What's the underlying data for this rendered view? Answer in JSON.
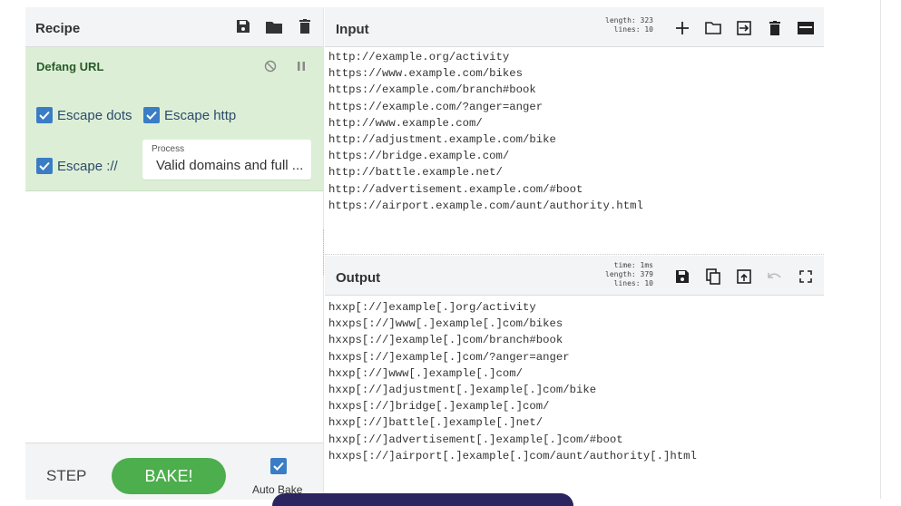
{
  "recipe": {
    "title": "Recipe",
    "icons": [
      "save-icon",
      "folder-icon",
      "trash-icon"
    ],
    "operation": {
      "name": "Defang URL",
      "escape_dots": {
        "label": "Escape dots",
        "checked": true
      },
      "escape_http": {
        "label": "Escape http",
        "checked": true
      },
      "escape_slashes": {
        "label": "Escape ://",
        "checked": true
      },
      "process": {
        "label": "Process",
        "value": "Valid domains and full ..."
      }
    },
    "step_label": "STEP",
    "bake_label": "BAKE!",
    "auto_bake": {
      "label": "Auto Bake",
      "checked": true
    }
  },
  "input": {
    "title": "Input",
    "length_label": "length: 323",
    "lines_label": "lines:  10",
    "text": "http://example.org/activity\nhttps://www.example.com/bikes\nhttps://example.com/branch#book\nhttps://example.com/?anger=anger\nhttp://www.example.com/\nhttp://adjustment.example.com/bike\nhttps://bridge.example.com/\nhttp://battle.example.net/\nhttp://advertisement.example.com/#boot\nhttps://airport.example.com/aunt/authority.html"
  },
  "output": {
    "title": "Output",
    "time_label": "time:  1ms",
    "length_label": "length: 379",
    "lines_label": "lines:  10",
    "text": "hxxp[://]example[.]org/activity\nhxxps[://]www[.]example[.]com/bikes\nhxxps[://]example[.]com/branch#book\nhxxps[://]example[.]com/?anger=anger\nhxxp[://]www[.]example[.]com/\nhxxp[://]adjustment[.]example[.]com/bike\nhxxps[://]bridge[.]example[.]com/\nhxxp[://]battle[.]example[.]net/\nhxxp[://]advertisement[.]example[.]com/#boot\nhxxps[://]airport[.]example[.]com/aunt/authority[.]html"
  },
  "colors": {
    "accent": "#3b7dc4",
    "operation_bg": "#dcefd6",
    "bake_green": "#4cae4c"
  }
}
